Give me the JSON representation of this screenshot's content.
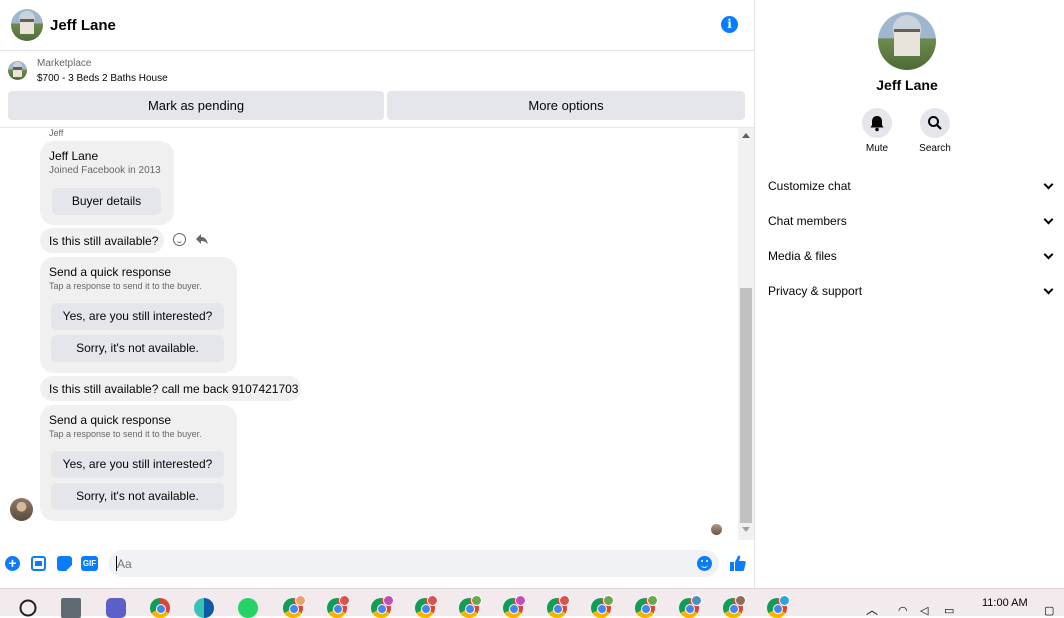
{
  "header": {
    "contact_name": "Jeff Lane",
    "info_icon": "info-icon"
  },
  "marketplace": {
    "label": "Marketplace",
    "listing_title": "$700 - 3 Beds 2 Baths House",
    "mark_pending_label": "Mark as pending",
    "more_options_label": "More options"
  },
  "chat": {
    "sender_label": "Jeff",
    "profile_card": {
      "name": "Jeff Lane",
      "joined": "Joined Facebook in 2013",
      "button": "Buyer details"
    },
    "messages": [
      "Is this still available?",
      "Is this still available? call me back 9107421703"
    ],
    "quick_response": {
      "title": "Send a quick response",
      "subtitle": "Tap a response to send it to the buyer.",
      "option_yes": "Yes, are you still interested?",
      "option_no": "Sorry, it's not available."
    }
  },
  "composer": {
    "placeholder": "Aa",
    "gif_label": "GIF"
  },
  "side": {
    "name": "Jeff Lane",
    "mute_label": "Mute",
    "search_label": "Search",
    "sections": [
      "Customize chat",
      "Chat members",
      "Media & files",
      "Privacy & support"
    ]
  },
  "taskbar": {
    "time": "11:00 AM"
  },
  "colors": {
    "accent": "#0a7cff",
    "bubble": "#f0f0f0",
    "button": "#e4e6eb"
  }
}
